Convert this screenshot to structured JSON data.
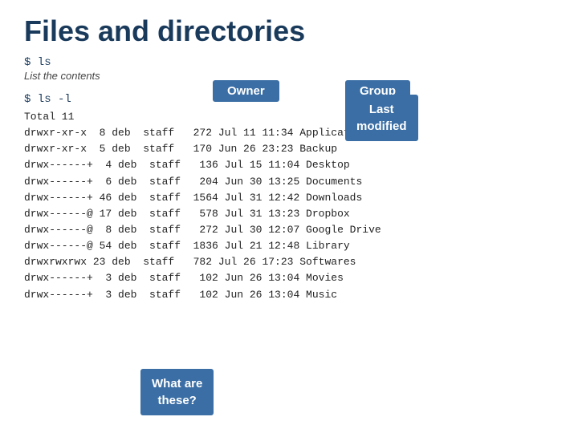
{
  "page": {
    "title": "Files and directories"
  },
  "commands": {
    "ls": "$ ls",
    "ls_description": "List the contents",
    "ls_l": "$ ls -l"
  },
  "callouts": {
    "owner": "Owner",
    "group": "Group",
    "last_modified": "Last\nmodified",
    "what_are_these": "What are\nthese?"
  },
  "file_listing": {
    "total": "Total 11",
    "rows": [
      {
        "perms": "drwxr-xr-x",
        "links": " 8",
        "owner": "deb",
        "group": "staff",
        "size": " 272",
        "month": "Jul",
        "day": "11",
        "time": "11:34",
        "name": "Applications"
      },
      {
        "perms": "drwxr-xr-x",
        "links": " 5",
        "owner": "deb",
        "group": "staff",
        "size": " 170",
        "month": "Jun",
        "day": "26",
        "time": "23:23",
        "name": "Backup"
      },
      {
        "perms": "drwx------+",
        "links": " 4",
        "owner": "deb",
        "group": "staff",
        "size": " 136",
        "month": "Jul",
        "day": "15",
        "time": "11:04",
        "name": "Desktop"
      },
      {
        "perms": "drwx------+",
        "links": " 6",
        "owner": "deb",
        "group": "staff",
        "size": " 204",
        "month": "Jun",
        "day": "30",
        "time": "13:25",
        "name": "Documents"
      },
      {
        "perms": "drwx------+",
        "links": "46",
        "owner": "deb",
        "group": "staff",
        "size": "1564",
        "month": "Jul",
        "day": "31",
        "time": "12:42",
        "name": "Downloads"
      },
      {
        "perms": "drwx------@",
        "links": "17",
        "owner": "deb",
        "group": "staff",
        "size": " 578",
        "month": "Jul",
        "day": "31",
        "time": "13:23",
        "name": "Dropbox"
      },
      {
        "perms": "drwx------@",
        "links": " 8",
        "owner": "deb",
        "group": "staff",
        "size": " 272",
        "month": "Jul",
        "day": "30",
        "time": "12:07",
        "name": "Google Drive"
      },
      {
        "perms": "drwx------@",
        "links": "54",
        "owner": "deb",
        "group": "staff",
        "size": "1836",
        "month": "Jul",
        "day": "21",
        "time": "12:48",
        "name": "Library"
      },
      {
        "perms": "drwxrwxrwx",
        "links": "23",
        "owner": "deb",
        "group": "staff",
        "size": " 782",
        "month": "Jul",
        "day": "26",
        "time": "17:23",
        "name": "Softwares"
      },
      {
        "perms": "drwx------+",
        "links": " 3",
        "owner": "deb",
        "group": "staff",
        "size": " 102",
        "month": "Jun",
        "day": "26",
        "time": "13:04",
        "name": "Movies"
      },
      {
        "perms": "drwx------+",
        "links": " 3",
        "owner": "deb",
        "group": "staff",
        "size": " 102",
        "month": "Jun",
        "day": "26",
        "time": "13:04",
        "name": "Music"
      }
    ]
  }
}
